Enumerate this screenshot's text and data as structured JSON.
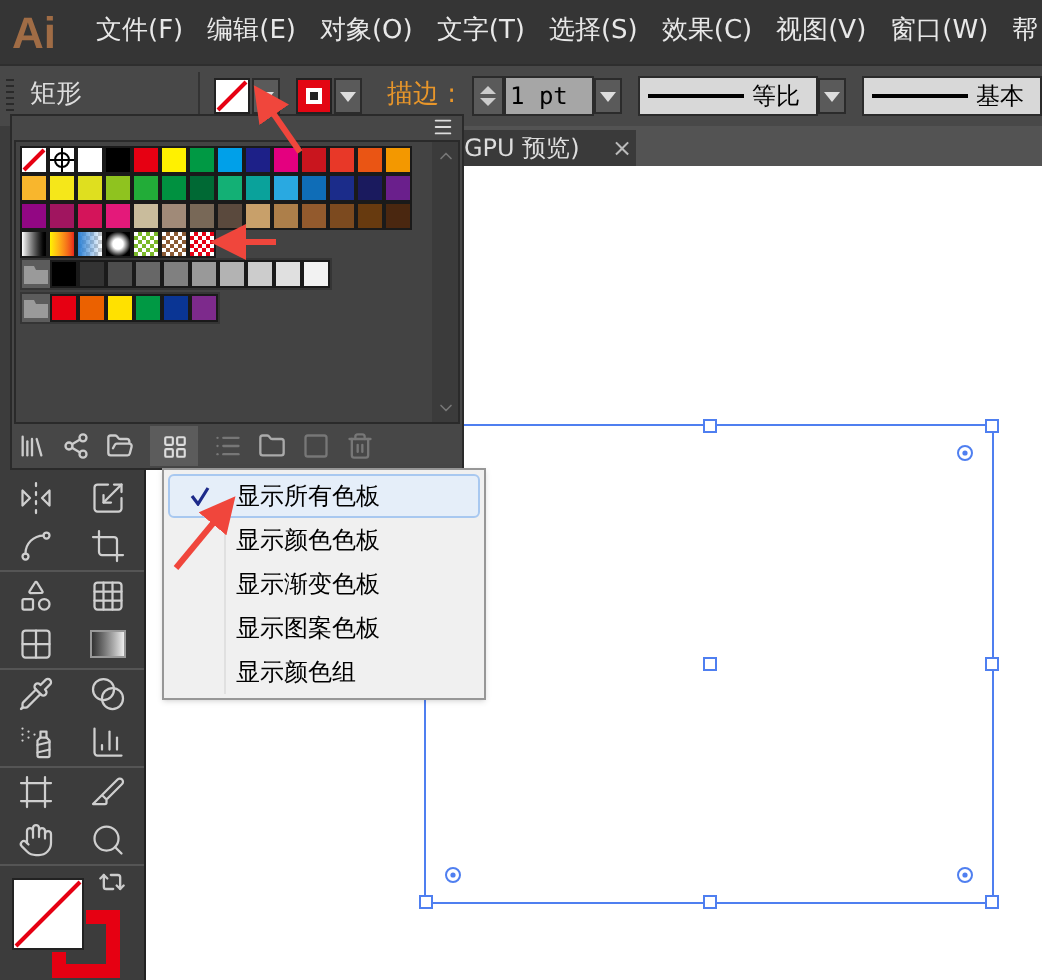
{
  "app_logo": "Ai",
  "menu_bar": [
    "文件(F)",
    "编辑(E)",
    "对象(O)",
    "文字(T)",
    "选择(S)",
    "效果(C)",
    "视图(V)",
    "窗口(W)",
    "帮"
  ],
  "control_bar": {
    "tool_name": "矩形",
    "fill": {
      "kind": "none"
    },
    "stroke": {
      "color": "#e30613"
    },
    "stroke_label": "描边 :",
    "stroke_weight": "1 pt",
    "profile": "等比",
    "brush": "基本"
  },
  "document_tab": {
    "title": "GPU 预览)",
    "close": "×"
  },
  "swatches": {
    "rows": [
      {
        "group": false,
        "items": [
          {
            "kind": "none"
          },
          {
            "kind": "registration"
          },
          {
            "kind": "color",
            "color": "#ffffff"
          },
          {
            "kind": "color",
            "color": "#000000"
          },
          {
            "kind": "color",
            "color": "#e60012"
          },
          {
            "kind": "color",
            "color": "#fff100"
          },
          {
            "kind": "color",
            "color": "#009944"
          },
          {
            "kind": "color",
            "color": "#00a0e9"
          },
          {
            "kind": "color",
            "color": "#1d2088"
          },
          {
            "kind": "color",
            "color": "#e4007f"
          },
          {
            "kind": "color",
            "color": "#c9151e"
          },
          {
            "kind": "color",
            "color": "#e83828"
          },
          {
            "kind": "color",
            "color": "#ea5514"
          },
          {
            "kind": "color",
            "color": "#f39800"
          }
        ]
      },
      {
        "group": false,
        "items": [
          {
            "kind": "color",
            "color": "#f8b62d"
          },
          {
            "kind": "color",
            "color": "#f5e71a"
          },
          {
            "kind": "color",
            "color": "#dfdf1f"
          },
          {
            "kind": "color",
            "color": "#8fc31f"
          },
          {
            "kind": "color",
            "color": "#22ac38"
          },
          {
            "kind": "color",
            "color": "#009140"
          },
          {
            "kind": "color",
            "color": "#006934"
          },
          {
            "kind": "color",
            "color": "#13b075"
          },
          {
            "kind": "color",
            "color": "#0aa29b"
          },
          {
            "kind": "color",
            "color": "#29a9e1"
          },
          {
            "kind": "color",
            "color": "#0f6db7"
          },
          {
            "kind": "color",
            "color": "#1b2c8a"
          },
          {
            "kind": "color",
            "color": "#1a1a5e"
          },
          {
            "kind": "color",
            "color": "#6a1f8c"
          }
        ]
      },
      {
        "group": false,
        "items": [
          {
            "kind": "color",
            "color": "#920783"
          },
          {
            "kind": "color",
            "color": "#a0155f"
          },
          {
            "kind": "color",
            "color": "#d4145a"
          },
          {
            "kind": "color",
            "color": "#e4197a"
          },
          {
            "kind": "color",
            "color": "#c9bc9c"
          },
          {
            "kind": "color",
            "color": "#a08a78"
          },
          {
            "kind": "color",
            "color": "#786857"
          },
          {
            "kind": "color",
            "color": "#5a493d"
          },
          {
            "kind": "color",
            "color": "#c8a06a"
          },
          {
            "kind": "color",
            "color": "#ad7f4a"
          },
          {
            "kind": "color",
            "color": "#935a2d"
          },
          {
            "kind": "color",
            "color": "#7c4a1f"
          },
          {
            "kind": "color",
            "color": "#673a0f"
          },
          {
            "kind": "color",
            "color": "#4a2710"
          }
        ]
      },
      {
        "group": false,
        "items": [
          {
            "kind": "gray-gradient"
          },
          {
            "kind": "warm-gradient"
          },
          {
            "kind": "transparency"
          },
          {
            "kind": "radial"
          },
          {
            "kind": "pattern",
            "color": "#7ab828"
          },
          {
            "kind": "pattern",
            "color": "#8a5a34"
          },
          {
            "kind": "pattern",
            "color": "#e60012"
          }
        ]
      },
      {
        "group": true,
        "items": [
          {
            "kind": "folder"
          },
          {
            "kind": "color",
            "color": "#000000"
          },
          {
            "kind": "color",
            "color": "#333333"
          },
          {
            "kind": "color",
            "color": "#4d4d4d"
          },
          {
            "kind": "color",
            "color": "#676767"
          },
          {
            "kind": "color",
            "color": "#808080"
          },
          {
            "kind": "color",
            "color": "#999999"
          },
          {
            "kind": "color",
            "color": "#b3b3b3"
          },
          {
            "kind": "color",
            "color": "#cccccc"
          },
          {
            "kind": "color",
            "color": "#e0e0e0"
          },
          {
            "kind": "color",
            "color": "#f2f2f2"
          }
        ]
      },
      {
        "group": true,
        "items": [
          {
            "kind": "folder"
          },
          {
            "kind": "color",
            "color": "#e60012"
          },
          {
            "kind": "color",
            "color": "#eb6100"
          },
          {
            "kind": "color",
            "color": "#ffe100"
          },
          {
            "kind": "color",
            "color": "#009944"
          },
          {
            "kind": "color",
            "color": "#0a3594"
          },
          {
            "kind": "color",
            "color": "#7d2a8c"
          }
        ]
      }
    ]
  },
  "popup_menu": [
    {
      "label": "显示所有色板",
      "checked": true,
      "selected": true
    },
    {
      "label": "显示颜色色板",
      "checked": false,
      "selected": false
    },
    {
      "label": "显示渐变色板",
      "checked": false,
      "selected": false
    },
    {
      "label": "显示图案色板",
      "checked": false,
      "selected": false
    },
    {
      "label": "显示颜色组",
      "checked": false,
      "selected": false
    }
  ]
}
